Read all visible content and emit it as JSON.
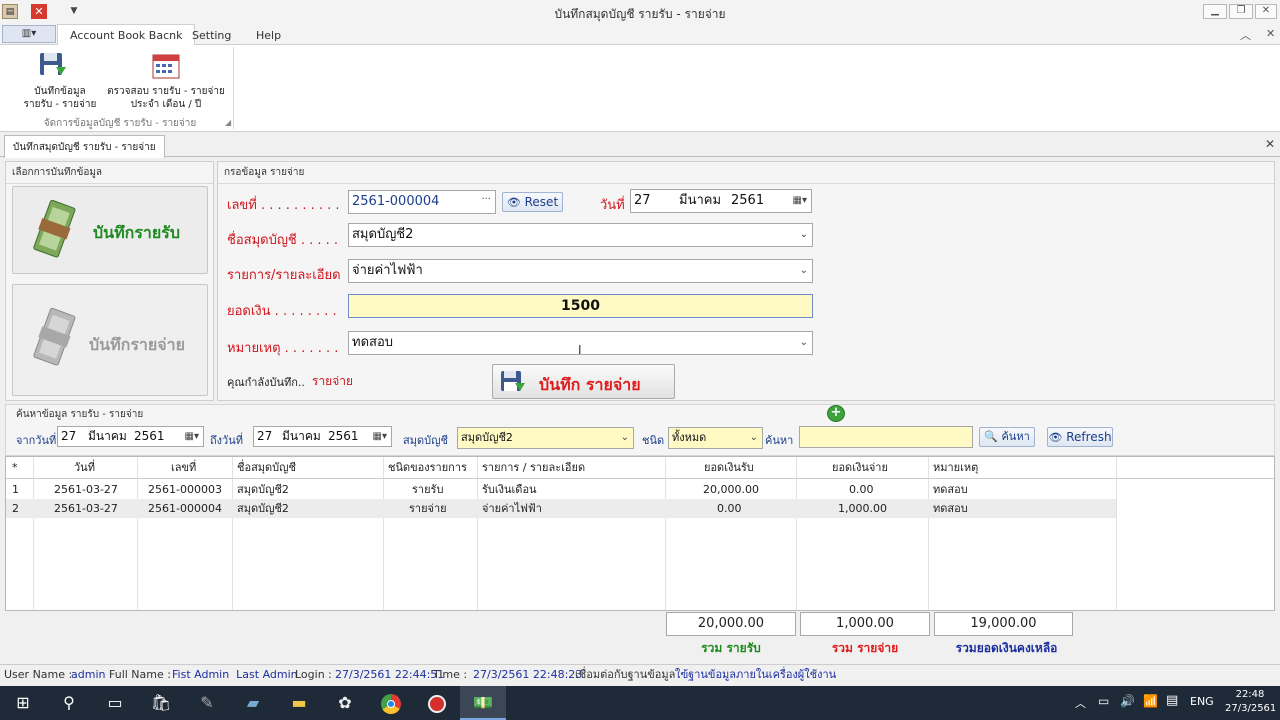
{
  "window": {
    "title": "บันทึกสมุดบัญชี รายรับ - รายจ่าย"
  },
  "ribbon": {
    "tabs": [
      "Account Book Bacnk",
      "Setting",
      "Help"
    ],
    "buttons": [
      {
        "label1": "บันทึกข้อมูล",
        "label2": "รายรับ - รายจ่าย"
      },
      {
        "label1": "ตรวจสอบ รายรับ - รายจ่าย",
        "label2": "ประจำ เดือน / ปี"
      }
    ],
    "group_label": "จัดการข้อมูลบัญชี รายรับ - รายจ่าย"
  },
  "doc_tab": {
    "label": "บันทึกสมุดบัญชี รายรับ - รายจ่าย"
  },
  "left_panel": {
    "header": "เลือกการบันทึกข้อมูล",
    "income_button": "บันทึกรายรับ",
    "expense_button": "บันทึกรายจ่าย"
  },
  "form": {
    "header": "กรอข้อมูล รายจ่าย",
    "number_label": "เลขที่ . . . . . . . . . .",
    "number_value": "2561-000004",
    "reset_label": "Reset",
    "date_label": "วันที่",
    "date_day": "27",
    "date_month": "มีนาคม",
    "date_year": "2561",
    "book_label": "ชื่อสมุดบัญชี . . . . .",
    "book_value": "สมุดบัญชี2",
    "item_label": "รายการ/รายละเอียด",
    "item_value": "จ่ายค่าไฟฟ้า",
    "amount_label": "ยอดเงิน . . . . . . . .",
    "amount_value": "1500",
    "note_label": "หมายเหตุ . . . . . . .",
    "note_value": "ทดสอบ",
    "mode_text": "คุณกำลังบันทึก..",
    "mode_value": "รายจ่าย",
    "save_label": "บันทึก รายจ่าย"
  },
  "search": {
    "header": "ค้นหาข้อมูล รายรับ - รายจ่าย",
    "from_label": "จากวันที่",
    "from_day": "27",
    "from_month": "มีนาคม",
    "from_year": "2561",
    "to_label": "ถึงวันที่",
    "to_day": "27",
    "to_month": "มีนาคม",
    "to_year": "2561",
    "book_label": "สมุดบัญชี",
    "book_value": "สมุดบัญชี2",
    "type_label": "ชนิด",
    "type_value": "ทั้งหมด",
    "query_label": "ค้นหา",
    "query_value": "",
    "search_button": "ค้นหา",
    "refresh_button": "Refresh"
  },
  "table": {
    "columns": [
      "*",
      "วันที่",
      "เลขที่",
      "ชื่อสมุดบัญชี",
      "ชนิดของรายการ",
      "รายการ / รายละเอียด",
      "ยอดเงินรับ",
      "ยอดเงินจ่าย",
      "หมายเหตุ"
    ],
    "rows": [
      [
        "1",
        "2561-03-27",
        "2561-000003",
        "สมุดบัญชี2",
        "รายรับ",
        "รับเงินเดือน",
        "20,000.00",
        "0.00",
        "ทดสอบ"
      ],
      [
        "2",
        "2561-03-27",
        "2561-000004",
        "สมุดบัญชี2",
        "รายจ่าย",
        "จ่ายค่าไฟฟ้า",
        "0.00",
        "1,000.00",
        "ทดสอบ"
      ]
    ]
  },
  "totals": {
    "income": "20,000.00",
    "income_label": "รวม รายรับ",
    "expense": "1,000.00",
    "expense_label": "รวม รายจ่าย",
    "balance": "19,000.00",
    "balance_label": "รวมยอดเงินคงเหลือ"
  },
  "status": {
    "user_label": "User Name :",
    "user": "admin",
    "full_label": "Full Name :",
    "full": "Fist Admin  Last Admin",
    "login_label": "Login :",
    "login": "27/3/2561 22:44:51",
    "time_label": "Time :",
    "time": "27/3/2561 22:48:23",
    "db_connect": "เชื่อมต่อกับฐานข้อมูล",
    "db_mode": "ใฃ้ฐานข้อมูลภายในเครื่องผู้ใช้งาน"
  },
  "taskbar": {
    "lang": "ENG",
    "clock_time": "22:48",
    "clock_date": "27/3/2561"
  },
  "colors": {
    "accent_red": "#d0141c",
    "income_green": "#1e8a1e",
    "expense_red": "#e01b1b",
    "balance_blue": "#1c2fa0",
    "amount_bg": "#fff9c4"
  }
}
